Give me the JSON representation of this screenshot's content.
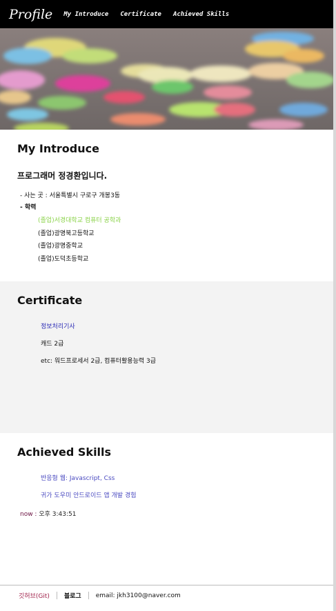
{
  "nav": {
    "brand": "Profile",
    "links": [
      "My Introduce",
      "Certificate",
      "Achieved Skills"
    ]
  },
  "introduce": {
    "title": "My Introduce",
    "headline": "프로그래머 정경환입니다.",
    "address_label": "- 사는 곳 : 서울특별시 구로구 개봉3동",
    "education_label": "- 학력",
    "education": [
      "(졸업)서경대학교 컴퓨터 공학과",
      "(졸업)광명북고등학교",
      "(졸업)광명중학교",
      "(졸업)도덕초등학교"
    ],
    "highlight_color": "#8bd34a"
  },
  "certificate": {
    "title": "Certificate",
    "items": [
      "정보처리기사",
      "캐드 2급",
      "etc: 워드프로세서 2급, 컴퓨터활용능력 3급"
    ],
    "link_color": "#2a2ab5"
  },
  "skills": {
    "title": "Achieved Skills",
    "items": [
      "반응형 웹: Javascript, Css",
      "귀가 도우미 안드로이드 앱 개발 경험"
    ],
    "now_label": "now : ",
    "now_value": "오후 3:43:51",
    "link_color": "#4a4ac0"
  },
  "footer": {
    "git": "깃허브(Git)",
    "blog": "블로그",
    "email": "email: jkh3100@naver.com",
    "git_color": "#a0204a"
  }
}
